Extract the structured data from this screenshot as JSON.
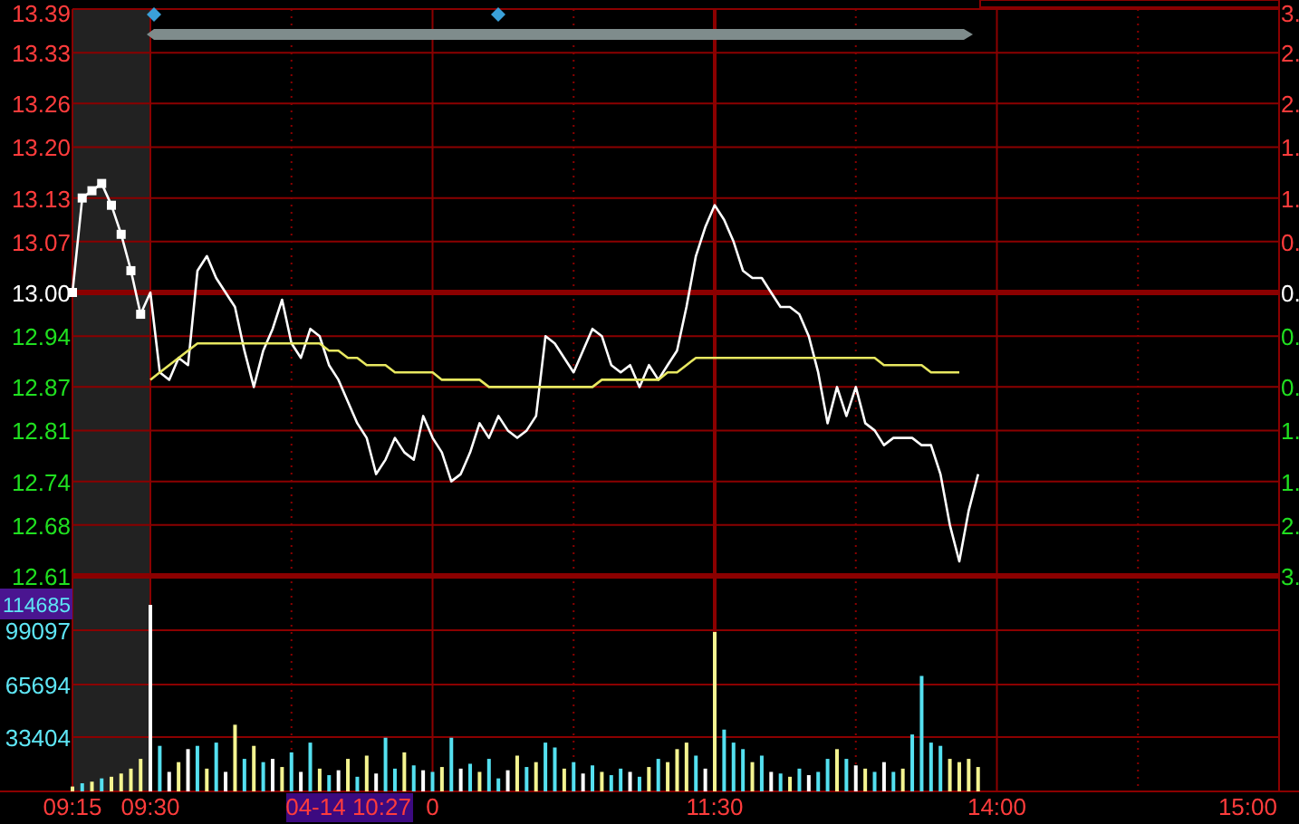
{
  "price_chart": {
    "chart_data": {
      "type": "line",
      "ylim": [
        12.61,
        13.39
      ],
      "yticks": [
        {
          "value": 13.39,
          "label": "13.39"
        },
        {
          "value": 13.33,
          "label": "13.33"
        },
        {
          "value": 13.26,
          "label": "13.26"
        },
        {
          "value": 13.2,
          "label": "13.20"
        },
        {
          "value": 13.13,
          "label": "13.13"
        },
        {
          "value": 13.07,
          "label": "13.07"
        },
        {
          "value": 13.0,
          "label": "13.00"
        },
        {
          "value": 12.94,
          "label": "12.94"
        },
        {
          "value": 12.87,
          "label": "12.87"
        },
        {
          "value": 12.81,
          "label": "12.81"
        },
        {
          "value": 12.74,
          "label": "12.74"
        },
        {
          "value": 12.68,
          "label": "12.68"
        },
        {
          "value": 12.61,
          "label": "12.61"
        }
      ],
      "categories": [
        null,
        null,
        null,
        null,
        null,
        null,
        null,
        null,
        null,
        null,
        null,
        null,
        null,
        null,
        null,
        null,
        null,
        null,
        null,
        null,
        null,
        null,
        null,
        null,
        null,
        null,
        null,
        null,
        null,
        null,
        null,
        null,
        null,
        null,
        null,
        null,
        null,
        null,
        null,
        null,
        null,
        null,
        null,
        null,
        null,
        null,
        null,
        null,
        null,
        null,
        null,
        null,
        null,
        null,
        null,
        null,
        null,
        null,
        null,
        null,
        null,
        null,
        null,
        null,
        null,
        null,
        null,
        null,
        null,
        null,
        null,
        null,
        null,
        null,
        null,
        null,
        null,
        null,
        null,
        null,
        null,
        null,
        null,
        null,
        null,
        null,
        null,
        null,
        null,
        null,
        null,
        null,
        null,
        null,
        null,
        null,
        null,
        null,
        null,
        null,
        null,
        null,
        null,
        null,
        null,
        null,
        null,
        null,
        null,
        null,
        null,
        null,
        null,
        null,
        null,
        null,
        null,
        null,
        null,
        null,
        null,
        null,
        null,
        null,
        null,
        null,
        null,
        null,
        null
      ],
      "series": [
        {
          "color": "#ffffff",
          "values": [
            13.0,
            13.13,
            13.14,
            13.15,
            13.12,
            13.08,
            13.03,
            12.97,
            13.0,
            12.89,
            12.88,
            12.91,
            12.9,
            13.03,
            13.05,
            13.02,
            13.0,
            12.98,
            12.92,
            12.87,
            12.92,
            12.95,
            12.99,
            12.93,
            12.91,
            12.95,
            12.94,
            12.9,
            12.88,
            12.85,
            12.82,
            12.8,
            12.75,
            12.77,
            12.8,
            12.78,
            12.77,
            12.83,
            12.8,
            12.78,
            12.74,
            12.75,
            12.78,
            12.82,
            12.8,
            12.83,
            12.81,
            12.8,
            12.81,
            12.83,
            12.94,
            12.93,
            12.91,
            12.89,
            12.92,
            12.95,
            12.94,
            12.9,
            12.89,
            12.9,
            12.87,
            12.9,
            12.88,
            12.9,
            12.92,
            12.98,
            13.05,
            13.09,
            13.12,
            13.1,
            13.07,
            13.03,
            13.02,
            13.02,
            13.0,
            12.98,
            12.98,
            12.97,
            12.94,
            12.89,
            12.82,
            12.87,
            12.83,
            12.87,
            12.82,
            12.81,
            12.79,
            12.8,
            12.8,
            12.8,
            12.79,
            12.79,
            12.75,
            12.68,
            12.63,
            12.7,
            12.75,
            null,
            null,
            null,
            null,
            null,
            null,
            null,
            null,
            null,
            null,
            null,
            null,
            null,
            null,
            null,
            null,
            null,
            null,
            null,
            null,
            null,
            null,
            null,
            null,
            null,
            null,
            null,
            null,
            null,
            null,
            null,
            null
          ]
        },
        {
          "color": "#e8e860",
          "values": [
            null,
            null,
            null,
            null,
            null,
            null,
            null,
            null,
            12.88,
            12.89,
            12.9,
            12.91,
            12.92,
            12.93,
            12.93,
            12.93,
            12.93,
            12.93,
            12.93,
            12.93,
            12.93,
            12.93,
            12.93,
            12.93,
            12.93,
            12.93,
            12.93,
            12.92,
            12.92,
            12.91,
            12.91,
            12.9,
            12.9,
            12.9,
            12.89,
            12.89,
            12.89,
            12.89,
            12.89,
            12.88,
            12.88,
            12.88,
            12.88,
            12.88,
            12.87,
            12.87,
            12.87,
            12.87,
            12.87,
            12.87,
            12.87,
            12.87,
            12.87,
            12.87,
            12.87,
            12.87,
            12.88,
            12.88,
            12.88,
            12.88,
            12.88,
            12.88,
            12.88,
            12.89,
            12.89,
            12.9,
            12.91,
            12.91,
            12.91,
            12.91,
            12.91,
            12.91,
            12.91,
            12.91,
            12.91,
            12.91,
            12.91,
            12.91,
            12.91,
            12.91,
            12.91,
            12.91,
            12.91,
            12.91,
            12.91,
            12.91,
            12.9,
            12.9,
            12.9,
            12.9,
            12.9,
            12.89,
            12.89,
            12.89,
            12.89,
            null,
            null,
            null,
            null,
            null,
            null,
            null,
            null,
            null,
            null,
            null,
            null,
            null,
            null,
            null,
            null,
            null,
            null,
            null,
            null,
            null,
            null,
            null,
            null,
            null,
            null,
            null,
            null,
            null,
            null,
            null,
            null,
            null,
            null
          ]
        }
      ]
    },
    "right_axis_labels": [
      {
        "text": "3.",
        "color": "#ff3c3c"
      },
      {
        "text": "2.",
        "color": "#ff3c3c"
      },
      {
        "text": "2.",
        "color": "#ff3c3c"
      },
      {
        "text": "1.",
        "color": "#ff3c3c"
      },
      {
        "text": "1.",
        "color": "#ff3c3c"
      },
      {
        "text": "0.",
        "color": "#ff3c3c"
      },
      {
        "text": "0.",
        "color": "#ffffff"
      },
      {
        "text": "0.",
        "color": "#20e020"
      },
      {
        "text": "0.",
        "color": "#20e020"
      },
      {
        "text": "1.",
        "color": "#20e020"
      },
      {
        "text": "1.",
        "color": "#20e020"
      },
      {
        "text": "2.",
        "color": "#20e020"
      },
      {
        "text": "3.",
        "color": "#20e020"
      }
    ]
  },
  "volume_chart": {
    "max_label": "114685",
    "chart_data": {
      "type": "bar",
      "ylim": [
        0,
        114685
      ],
      "yticks": [
        {
          "value": 33404,
          "label": "33404"
        },
        {
          "value": 65694,
          "label": "65694"
        },
        {
          "value": 99097,
          "label": "99097"
        }
      ],
      "categories": [
        "09:15",
        null,
        null,
        null,
        null,
        null,
        null,
        null,
        "09:30",
        null,
        null,
        null,
        null,
        null,
        null,
        null,
        null,
        null,
        null,
        null,
        null,
        null,
        null,
        null,
        null,
        null,
        null,
        null,
        null,
        null,
        null,
        null,
        null,
        null,
        null,
        null,
        null,
        null,
        "0",
        null,
        null,
        null,
        null,
        null,
        null,
        null,
        null,
        null,
        null,
        null,
        null,
        null,
        null,
        null,
        null,
        null,
        null,
        null,
        null,
        null,
        null,
        null,
        null,
        null,
        null,
        null,
        null,
        null,
        "11:30",
        null,
        null,
        null,
        null,
        null,
        null,
        null,
        null,
        null,
        null,
        null,
        null,
        null,
        null,
        null,
        null,
        null,
        null,
        null,
        null,
        null,
        null,
        null,
        null,
        null,
        null,
        null,
        null,
        null,
        "14:00",
        null,
        null,
        null,
        null,
        null,
        null,
        null,
        null,
        null,
        null,
        null,
        null,
        null,
        null,
        null,
        null,
        null,
        null,
        null,
        null,
        null,
        null,
        null,
        null,
        null,
        null,
        null,
        null,
        null,
        "15:00"
      ],
      "series": [
        {
          "values": [
            3000,
            5000,
            6000,
            8000,
            9000,
            11000,
            14000,
            20000,
            114685,
            28000,
            12000,
            18000,
            26000,
            28000,
            14000,
            30000,
            12000,
            41000,
            20000,
            28000,
            18000,
            20000,
            15000,
            24000,
            12000,
            30000,
            14000,
            10000,
            13000,
            20000,
            9000,
            22000,
            11000,
            33000,
            14000,
            24000,
            16000,
            13000,
            12000,
            15000,
            33000,
            14000,
            17000,
            12000,
            20000,
            8000,
            13000,
            22000,
            15000,
            18000,
            30000,
            27000,
            14000,
            18000,
            11000,
            16000,
            12000,
            10000,
            14000,
            12000,
            9000,
            15000,
            20000,
            18000,
            26000,
            30000,
            22000,
            14000,
            98000,
            38000,
            30000,
            26000,
            18000,
            22000,
            12000,
            11000,
            9000,
            14000,
            10000,
            12000,
            20000,
            26000,
            20000,
            16000,
            14000,
            12000,
            18000,
            12000,
            14000,
            35000,
            71000,
            30000,
            28000,
            20000,
            18000,
            20000,
            15000,
            null,
            null,
            null,
            null,
            null,
            null,
            null,
            null,
            null,
            null,
            null,
            null,
            null,
            null,
            null,
            null,
            null,
            null,
            null,
            null,
            null,
            null,
            null,
            null,
            null,
            null,
            null,
            null,
            null,
            null,
            null,
            null
          ],
          "colors": [
            "#f4f490",
            "#54e0f0",
            "#f4f490",
            "#54e0f0",
            "#f4f490",
            "#f4f490",
            "#f4f490",
            "#f4f490",
            "#ffffff",
            "#54e0f0",
            "#ffffff",
            "#f4f490",
            "#ffffff",
            "#54e0f0",
            "#f4f490",
            "#54e0f0",
            "#ffffff",
            "#f4f490",
            "#54e0f0",
            "#f4f490",
            "#54e0f0",
            "#ffffff",
            "#f4f490",
            "#54e0f0",
            "#ffffff",
            "#54e0f0",
            "#f4f490",
            "#54e0f0",
            "#ffffff",
            "#f4f490",
            "#54e0f0",
            "#f4f490",
            "#ffffff",
            "#54e0f0",
            "#54e0f0",
            "#f4f490",
            "#54e0f0",
            "#ffffff",
            "#54e0f0",
            "#f4f490",
            "#54e0f0",
            "#ffffff",
            "#54e0f0",
            "#f4f490",
            "#54e0f0",
            "#54e0f0",
            "#ffffff",
            "#f4f490",
            "#54e0f0",
            "#f4f490",
            "#54e0f0",
            "#54e0f0",
            "#f4f490",
            "#54e0f0",
            "#ffffff",
            "#54e0f0",
            "#f4f490",
            "#54e0f0",
            "#54e0f0",
            "#ffffff",
            "#54e0f0",
            "#f4f490",
            "#54e0f0",
            "#f4f490",
            "#f4f490",
            "#f4f490",
            "#54e0f0",
            "#ffffff",
            "#f4f490",
            "#54e0f0",
            "#54e0f0",
            "#54e0f0",
            "#f4f490",
            "#54e0f0",
            "#ffffff",
            "#54e0f0",
            "#f4f490",
            "#54e0f0",
            "#ffffff",
            "#54e0f0",
            "#54e0f0",
            "#f4f490",
            "#54e0f0",
            "#ffffff",
            "#f4f490",
            "#54e0f0",
            "#ffffff",
            "#54e0f0",
            "#f4f490",
            "#54e0f0",
            "#54e0f0",
            "#54e0f0",
            "#54e0f0",
            "#f4f490",
            "#f4f490",
            "#f4f490",
            "#f4f490",
            null,
            null,
            null,
            null,
            null,
            null,
            null,
            null,
            null,
            null,
            null,
            null,
            null,
            null,
            null,
            null,
            null,
            null,
            null,
            null,
            null,
            null,
            null,
            null,
            null,
            null,
            null,
            null,
            null,
            null,
            null,
            null
          ]
        }
      ]
    }
  },
  "cursor_label": "04-14 10:27"
}
